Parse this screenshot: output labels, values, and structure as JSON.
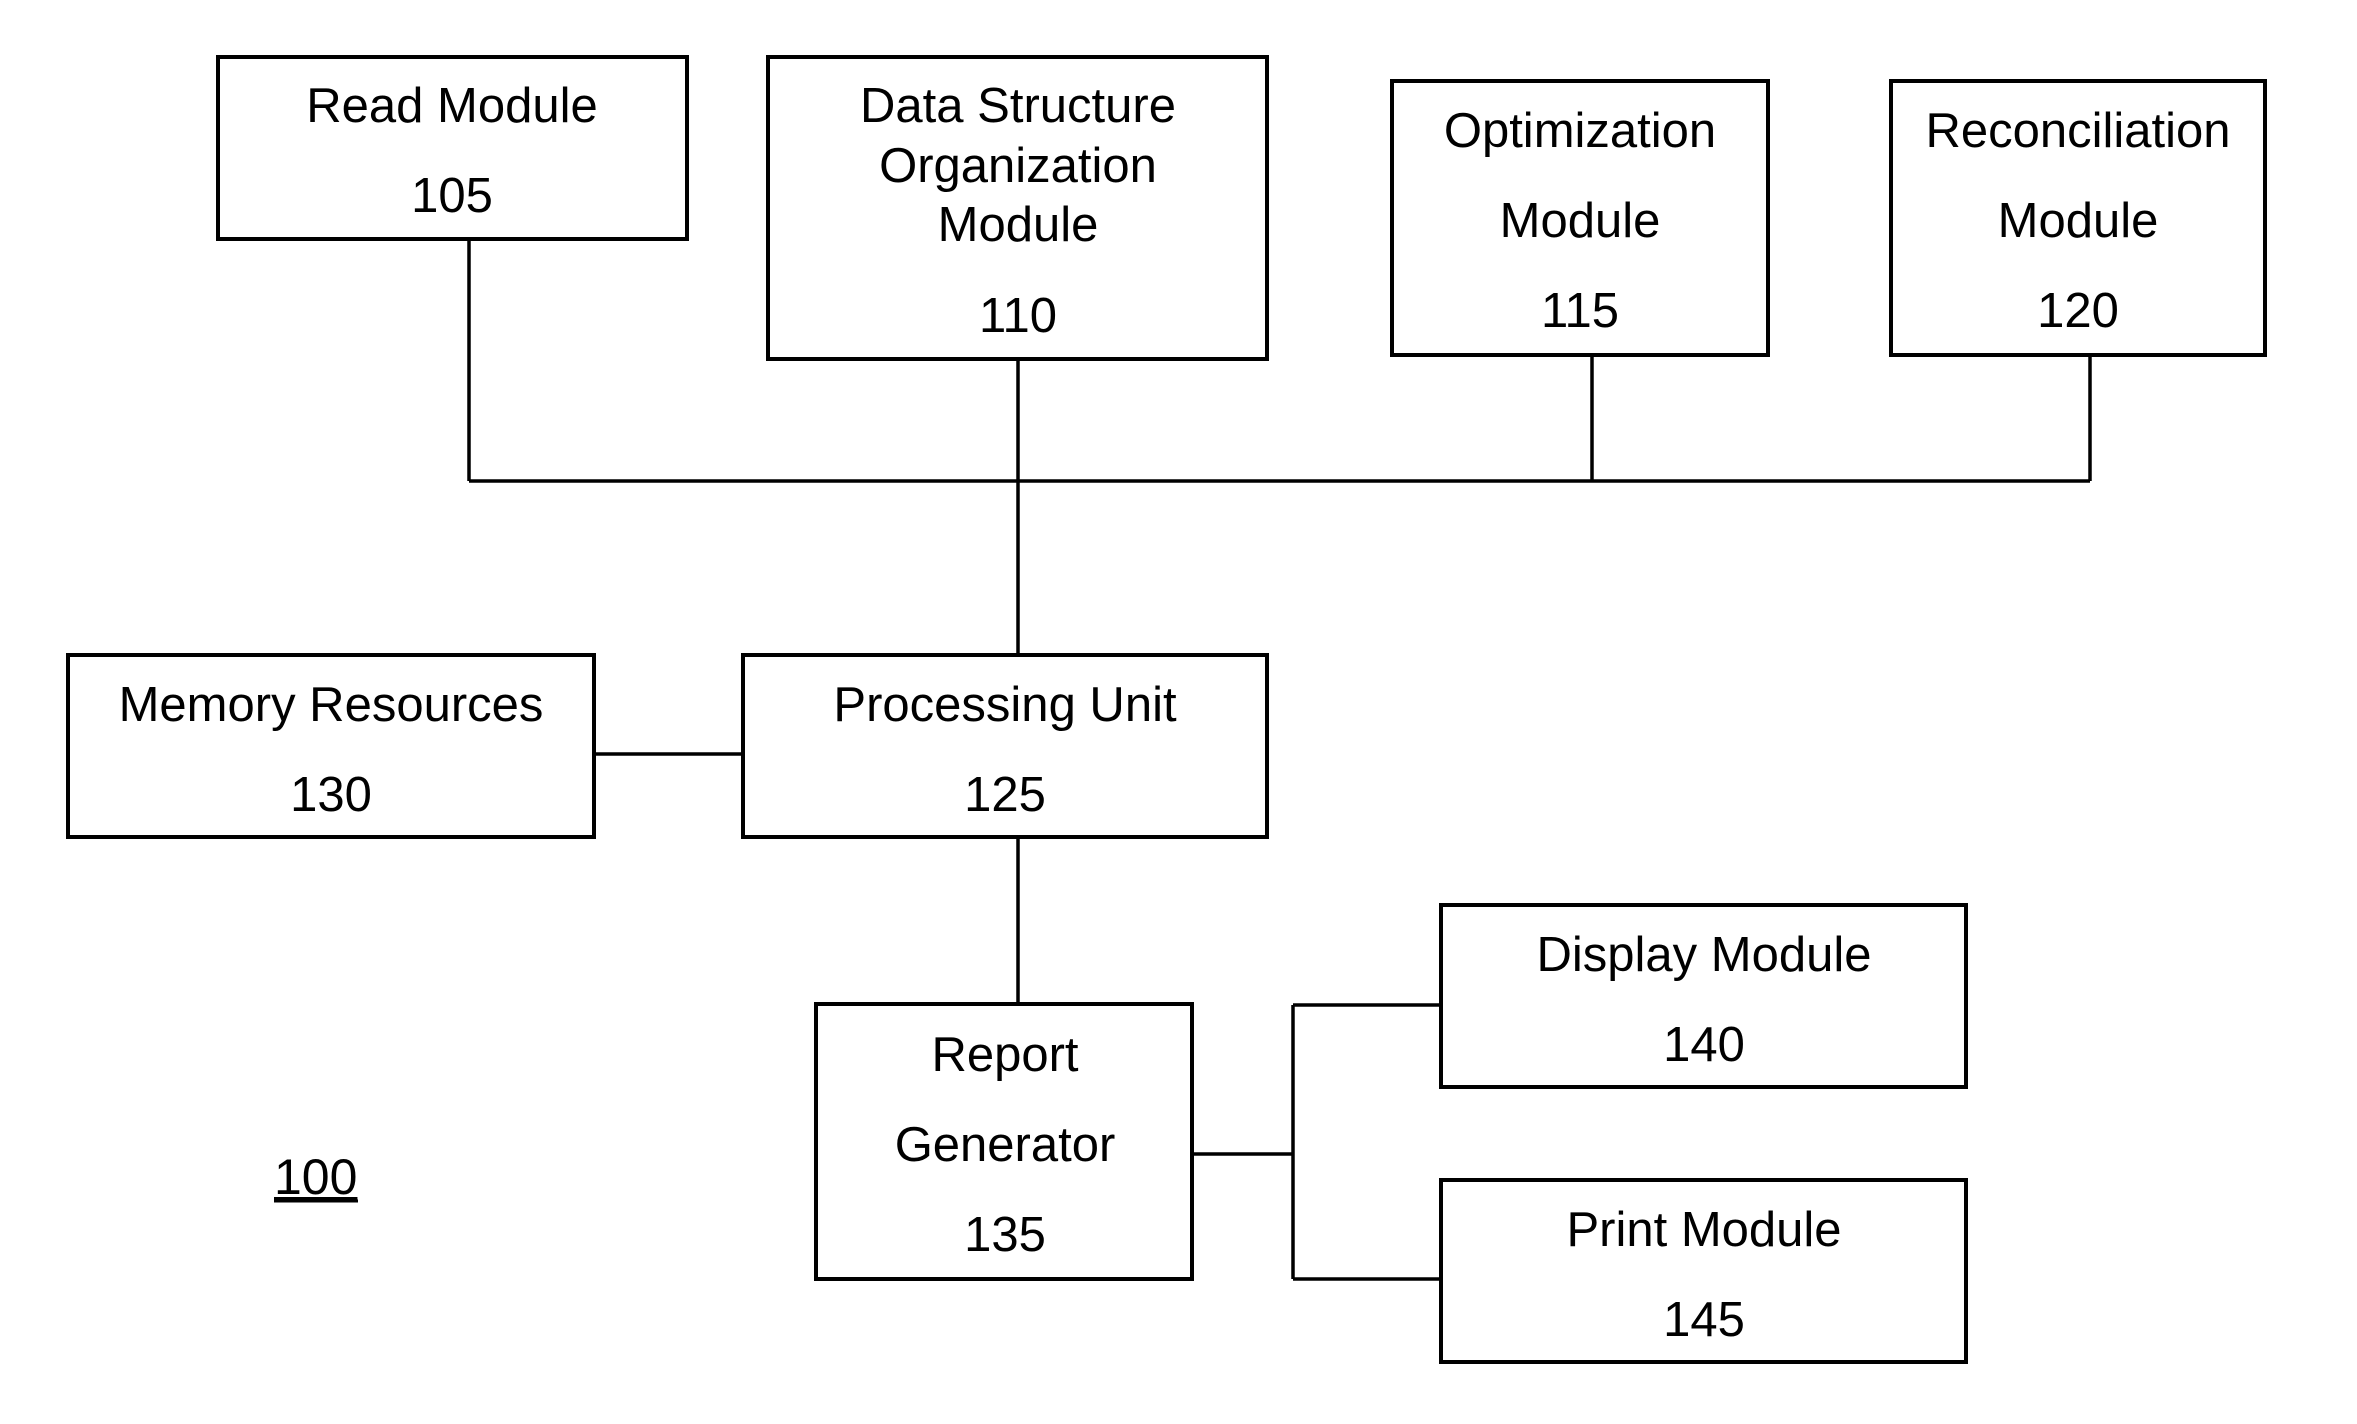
{
  "figure": {
    "reference_label": "100"
  },
  "colors": {
    "line": "#000000",
    "background": "#ffffff"
  },
  "blocks": {
    "read_module": {
      "lines": [
        "Read Module",
        "105"
      ]
    },
    "data_structure_module": {
      "lines": [
        "Data Structure",
        "Organization",
        "Module",
        "110"
      ]
    },
    "optimization_module": {
      "lines": [
        "Optimization",
        "Module",
        "115"
      ]
    },
    "reconciliation_module": {
      "lines": [
        "Reconciliation",
        "Module",
        "120"
      ]
    },
    "memory_resources": {
      "lines": [
        "Memory Resources",
        "130"
      ]
    },
    "processing_unit": {
      "lines": [
        "Processing Unit",
        "125"
      ]
    },
    "report_generator": {
      "lines": [
        "Report",
        "Generator",
        "135"
      ]
    },
    "display_module": {
      "lines": [
        "Display Module",
        "140"
      ]
    },
    "print_module": {
      "lines": [
        "Print Module",
        "145"
      ]
    }
  },
  "connections": [
    {
      "from": "read_module",
      "to": "processing_unit"
    },
    {
      "from": "data_structure_module",
      "to": "processing_unit"
    },
    {
      "from": "optimization_module",
      "to": "processing_unit"
    },
    {
      "from": "reconciliation_module",
      "to": "processing_unit"
    },
    {
      "from": "memory_resources",
      "to": "processing_unit"
    },
    {
      "from": "processing_unit",
      "to": "report_generator"
    },
    {
      "from": "report_generator",
      "to": "display_module"
    },
    {
      "from": "report_generator",
      "to": "print_module"
    }
  ]
}
